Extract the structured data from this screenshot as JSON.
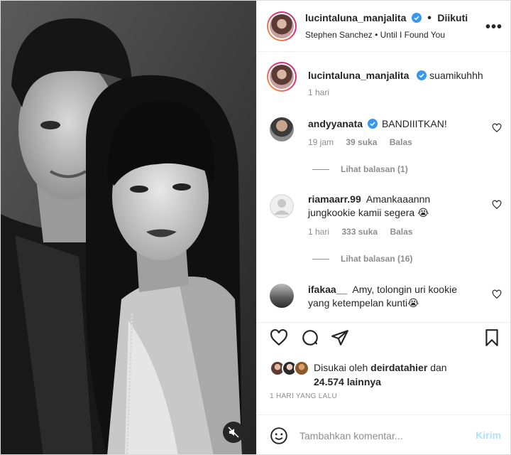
{
  "header": {
    "username": "lucintaluna_manjalita",
    "follow_status": "Diikuti",
    "audio": "Stephen Sanchez • Until I Found You"
  },
  "caption": {
    "username": "lucintaluna_manjalita",
    "text": "suamikuhhh",
    "time": "1 hari"
  },
  "comments": [
    {
      "username": "andyyanata",
      "text": "BANDIIITKAN!",
      "time": "19 jam",
      "likes": "39 suka",
      "reply": "Balas",
      "view_replies": "Lihat balasan (1)"
    },
    {
      "username": "riamaarr.99",
      "text": "Amankaaannn jungkookie kamii segera 😭",
      "time": "1 hari",
      "likes": "333 suka",
      "reply": "Balas",
      "view_replies": "Lihat balasan (16)"
    },
    {
      "username": "ifakaa__",
      "text": "Amy, tolongin uri kookie yang ketempelan kunti😭"
    }
  ],
  "likes": {
    "prefix": "Disukai oleh",
    "user": "deirdatahier",
    "suffix": "dan",
    "others": "24.574 lainnya"
  },
  "post_time": "1 HARI YANG LALU",
  "composer": {
    "placeholder": "Tambahkan komentar...",
    "send_label": "Kirim"
  },
  "icons": {
    "verified": "verified-badge-icon",
    "more": "more-options-icon",
    "heart": "heart-icon",
    "comment": "comment-icon",
    "share": "share-icon",
    "save": "bookmark-icon",
    "emoji": "emoji-icon",
    "mute": "muted-speaker-icon"
  },
  "colors": {
    "verified": "#3897f0",
    "send_disabled": "#b2dffc",
    "secondary_text": "#8e8e8e"
  }
}
